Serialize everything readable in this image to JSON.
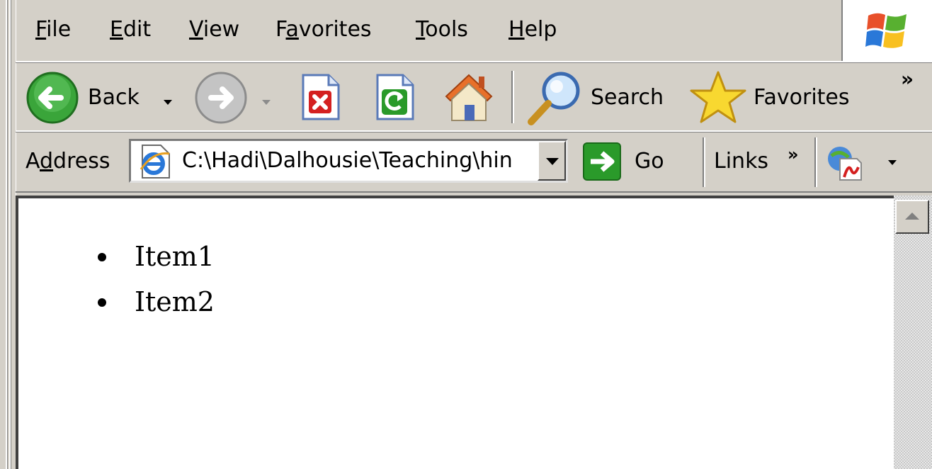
{
  "menu": {
    "file": "ile",
    "file_u": "F",
    "edit": "dit",
    "edit_u": "E",
    "view": "iew",
    "view_u": "V",
    "favorites_pre": "F",
    "favorites_u": "a",
    "favorites_post": "vorites",
    "tools": "ools",
    "tools_u": "T",
    "help": "elp",
    "help_u": "H"
  },
  "toolbar": {
    "back_label": "Back",
    "search_label": "Search",
    "favorites_label": "Favorites",
    "overflow": "»"
  },
  "address": {
    "label_pre": "A",
    "label_u": "d",
    "label_post": "dress",
    "url": "C:\\Hadi\\Dalhousie\\Teaching\\hin",
    "go_label": "Go",
    "links_label": "Links",
    "links_overflow": "»"
  },
  "page": {
    "items": [
      "Item1",
      "Item2"
    ]
  },
  "icons": {
    "back": "back-arrow-icon",
    "forward": "forward-arrow-icon",
    "stop": "stop-icon",
    "refresh": "refresh-icon",
    "home": "home-icon",
    "search": "search-icon",
    "favorites": "star-icon",
    "ie": "ie-page-icon",
    "go": "go-arrow-icon",
    "pdf": "pdf-icon",
    "windows": "windows-logo-icon"
  },
  "colors": {
    "chrome": "#d4d0c8",
    "go_green": "#2a9a2a",
    "back_green": "#3aa53a"
  }
}
